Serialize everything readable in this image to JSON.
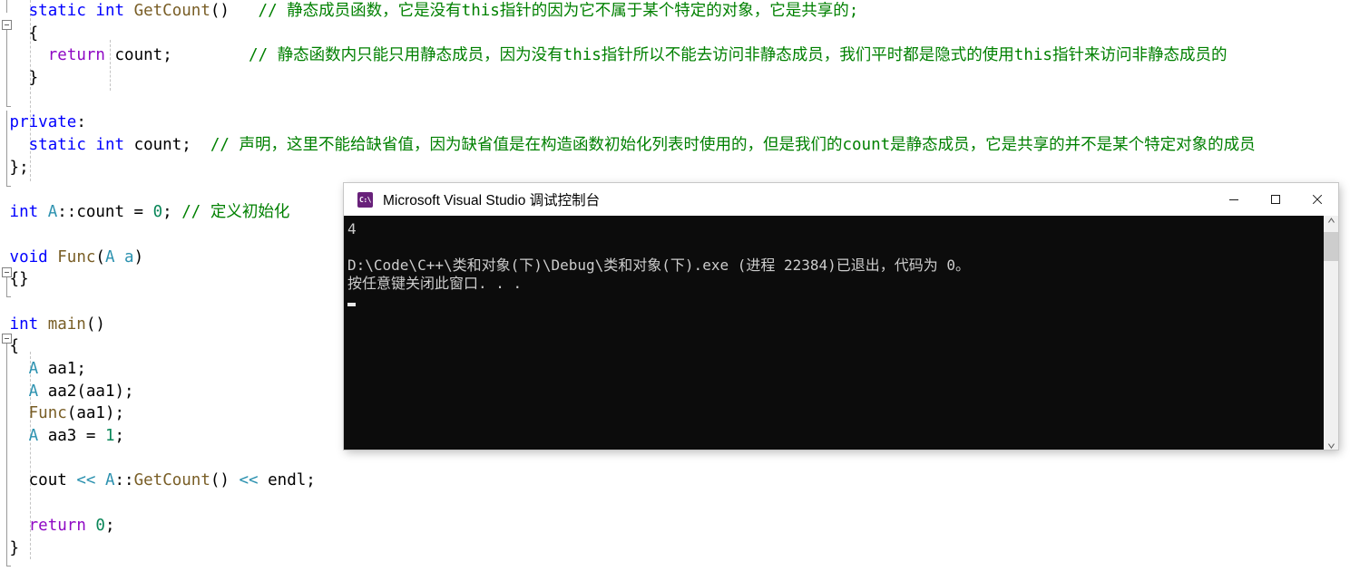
{
  "editor": {
    "lines": [
      {
        "indent": 3,
        "tokens": [
          {
            "t": "static",
            "c": "kw"
          },
          {
            "t": " ",
            "c": "plain"
          },
          {
            "t": "int",
            "c": "kw"
          },
          {
            "t": " ",
            "c": "plain"
          },
          {
            "t": "GetCount",
            "c": "fn"
          },
          {
            "t": "()",
            "c": "plain"
          },
          {
            "t": "   ",
            "c": "plain"
          },
          {
            "t": "// 静态成员函数，它是没有this指针的因为它不属于某个特定的对象，它是共享的;",
            "c": "cmt"
          }
        ]
      },
      {
        "indent": 3,
        "tokens": [
          {
            "t": "{",
            "c": "plain"
          }
        ]
      },
      {
        "indent": 5,
        "tokens": [
          {
            "t": "return",
            "c": "kwp"
          },
          {
            "t": " ",
            "c": "plain"
          },
          {
            "t": "count",
            "c": "plain"
          },
          {
            "t": ";",
            "c": "plain"
          },
          {
            "t": "        ",
            "c": "plain"
          },
          {
            "t": "// 静态函数内只能只用静态成员，因为没有this指针所以不能去访问非静态成员，我们平时都是隐式的使用this指针来访问非静态成员的",
            "c": "cmt"
          }
        ]
      },
      {
        "indent": 3,
        "tokens": [
          {
            "t": "}",
            "c": "plain"
          }
        ]
      },
      {
        "indent": 0,
        "tokens": []
      },
      {
        "indent": 1,
        "tokens": [
          {
            "t": "private",
            "c": "kw"
          },
          {
            "t": ":",
            "c": "plain"
          }
        ]
      },
      {
        "indent": 3,
        "tokens": [
          {
            "t": "static",
            "c": "kw"
          },
          {
            "t": " ",
            "c": "plain"
          },
          {
            "t": "int",
            "c": "kw"
          },
          {
            "t": " ",
            "c": "plain"
          },
          {
            "t": "count",
            "c": "plain"
          },
          {
            "t": ";",
            "c": "plain"
          },
          {
            "t": "  ",
            "c": "plain"
          },
          {
            "t": "// 声明，这里不能给缺省值，因为缺省值是在构造函数初始化列表时使用的，但是我们的count是静态成员，它是共享的并不是某个特定对象的成员",
            "c": "cmt"
          }
        ]
      },
      {
        "indent": 1,
        "tokens": [
          {
            "t": "};",
            "c": "plain"
          }
        ]
      },
      {
        "indent": 0,
        "tokens": []
      },
      {
        "indent": 1,
        "tokens": [
          {
            "t": "int",
            "c": "kw"
          },
          {
            "t": " ",
            "c": "plain"
          },
          {
            "t": "A",
            "c": "type"
          },
          {
            "t": "::",
            "c": "plain"
          },
          {
            "t": "count",
            "c": "plain"
          },
          {
            "t": " = ",
            "c": "plain"
          },
          {
            "t": "0",
            "c": "num"
          },
          {
            "t": "; ",
            "c": "plain"
          },
          {
            "t": "// 定义初始化",
            "c": "cmt"
          }
        ]
      },
      {
        "indent": 0,
        "tokens": []
      },
      {
        "indent": 1,
        "tokens": [
          {
            "t": "void",
            "c": "kw"
          },
          {
            "t": " ",
            "c": "plain"
          },
          {
            "t": "Func",
            "c": "fn"
          },
          {
            "t": "(",
            "c": "plain"
          },
          {
            "t": "A",
            "c": "type"
          },
          {
            "t": " ",
            "c": "plain"
          },
          {
            "t": "a",
            "c": "type"
          },
          {
            "t": ")",
            "c": "plain"
          }
        ]
      },
      {
        "indent": 1,
        "tokens": [
          {
            "t": "{}",
            "c": "plain"
          }
        ]
      },
      {
        "indent": 0,
        "tokens": []
      },
      {
        "indent": 1,
        "tokens": [
          {
            "t": "int",
            "c": "kw"
          },
          {
            "t": " ",
            "c": "plain"
          },
          {
            "t": "main",
            "c": "fn"
          },
          {
            "t": "()",
            "c": "plain"
          }
        ]
      },
      {
        "indent": 1,
        "tokens": [
          {
            "t": "{",
            "c": "plain"
          }
        ]
      },
      {
        "indent": 3,
        "tokens": [
          {
            "t": "A",
            "c": "type"
          },
          {
            "t": " aa1;",
            "c": "plain"
          }
        ]
      },
      {
        "indent": 3,
        "tokens": [
          {
            "t": "A",
            "c": "type"
          },
          {
            "t": " aa2(aa1);",
            "c": "plain"
          }
        ]
      },
      {
        "indent": 3,
        "tokens": [
          {
            "t": "Func",
            "c": "fn"
          },
          {
            "t": "(aa1);",
            "c": "plain"
          }
        ]
      },
      {
        "indent": 3,
        "tokens": [
          {
            "t": "A",
            "c": "type"
          },
          {
            "t": " aa3 = ",
            "c": "plain"
          },
          {
            "t": "1",
            "c": "num"
          },
          {
            "t": ";",
            "c": "plain"
          }
        ]
      },
      {
        "indent": 0,
        "tokens": []
      },
      {
        "indent": 3,
        "tokens": [
          {
            "t": "cout",
            "c": "plain"
          },
          {
            "t": " ",
            "c": "plain"
          },
          {
            "t": "<<",
            "c": "type"
          },
          {
            "t": " ",
            "c": "plain"
          },
          {
            "t": "A",
            "c": "type"
          },
          {
            "t": "::",
            "c": "plain"
          },
          {
            "t": "GetCount",
            "c": "fn"
          },
          {
            "t": "()",
            "c": "plain"
          },
          {
            "t": " ",
            "c": "plain"
          },
          {
            "t": "<<",
            "c": "type"
          },
          {
            "t": " ",
            "c": "plain"
          },
          {
            "t": "endl",
            "c": "plain"
          },
          {
            "t": ";",
            "c": "plain"
          }
        ]
      },
      {
        "indent": 0,
        "tokens": []
      },
      {
        "indent": 3,
        "tokens": [
          {
            "t": "return",
            "c": "kwp"
          },
          {
            "t": " ",
            "c": "plain"
          },
          {
            "t": "0",
            "c": "num"
          },
          {
            "t": ";",
            "c": "plain"
          }
        ]
      },
      {
        "indent": 1,
        "tokens": [
          {
            "t": "}",
            "c": "plain"
          }
        ]
      }
    ],
    "colors": {
      "keyword": "#0000ff",
      "keyword_control": "#8f08c4",
      "type": "#2b91af",
      "function": "#795e26",
      "comment": "#008000",
      "number": "#098658",
      "background": "#ffffff",
      "foreground": "#000000"
    }
  },
  "console": {
    "title": "Microsoft Visual Studio 调试控制台",
    "icon": "console-app-icon",
    "output_line_1": "4",
    "output_blank": "",
    "output_line_2": "D:\\Code\\C++\\类和对象(下)\\Debug\\类和对象(下).exe (进程 22384)已退出，代码为 0。",
    "output_line_3": "按任意键关闭此窗口. . .",
    "background": "#0c0c0c",
    "foreground": "#cccccc",
    "controls": {
      "minimize": "minimize",
      "maximize": "maximize",
      "close": "close"
    },
    "scrollbar": {
      "up_arrow": "⌃",
      "down_arrow": "⌄"
    }
  }
}
